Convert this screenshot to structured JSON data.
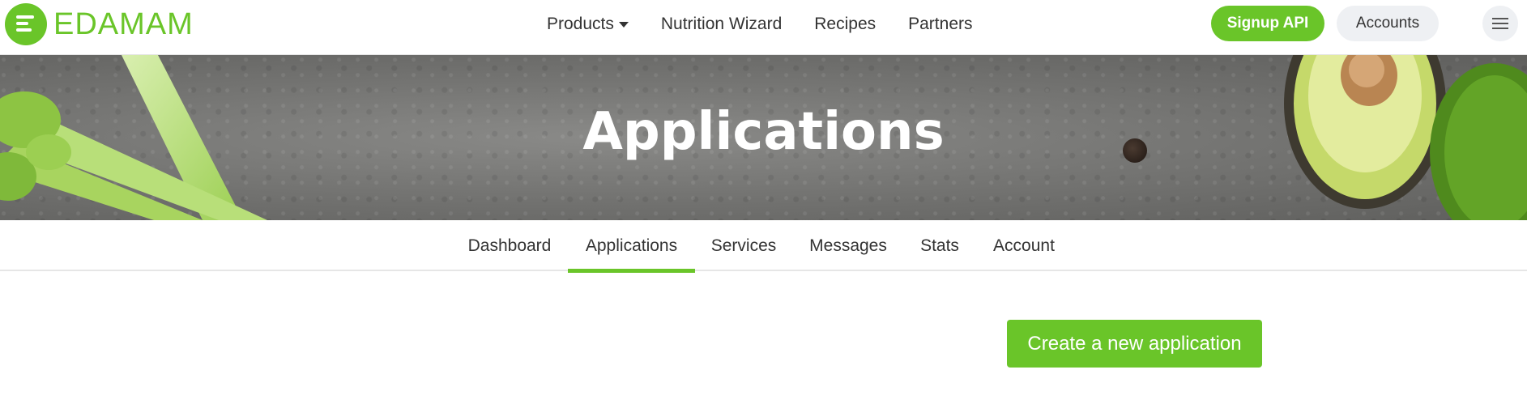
{
  "brand": {
    "name": "EDAMAM",
    "color": "#6ac529"
  },
  "header": {
    "nav": [
      {
        "label": "Products",
        "has_dropdown": true
      },
      {
        "label": "Nutrition Wizard"
      },
      {
        "label": "Recipes"
      },
      {
        "label": "Partners"
      }
    ],
    "signup_label": "Signup API",
    "accounts_label": "Accounts",
    "menu_icon": "hamburger-menu-icon"
  },
  "hero": {
    "title": "Applications"
  },
  "tabs": [
    {
      "label": "Dashboard",
      "active": false
    },
    {
      "label": "Applications",
      "active": true
    },
    {
      "label": "Services",
      "active": false
    },
    {
      "label": "Messages",
      "active": false
    },
    {
      "label": "Stats",
      "active": false
    },
    {
      "label": "Account",
      "active": false
    }
  ],
  "main": {
    "create_label": "Create a new application"
  }
}
